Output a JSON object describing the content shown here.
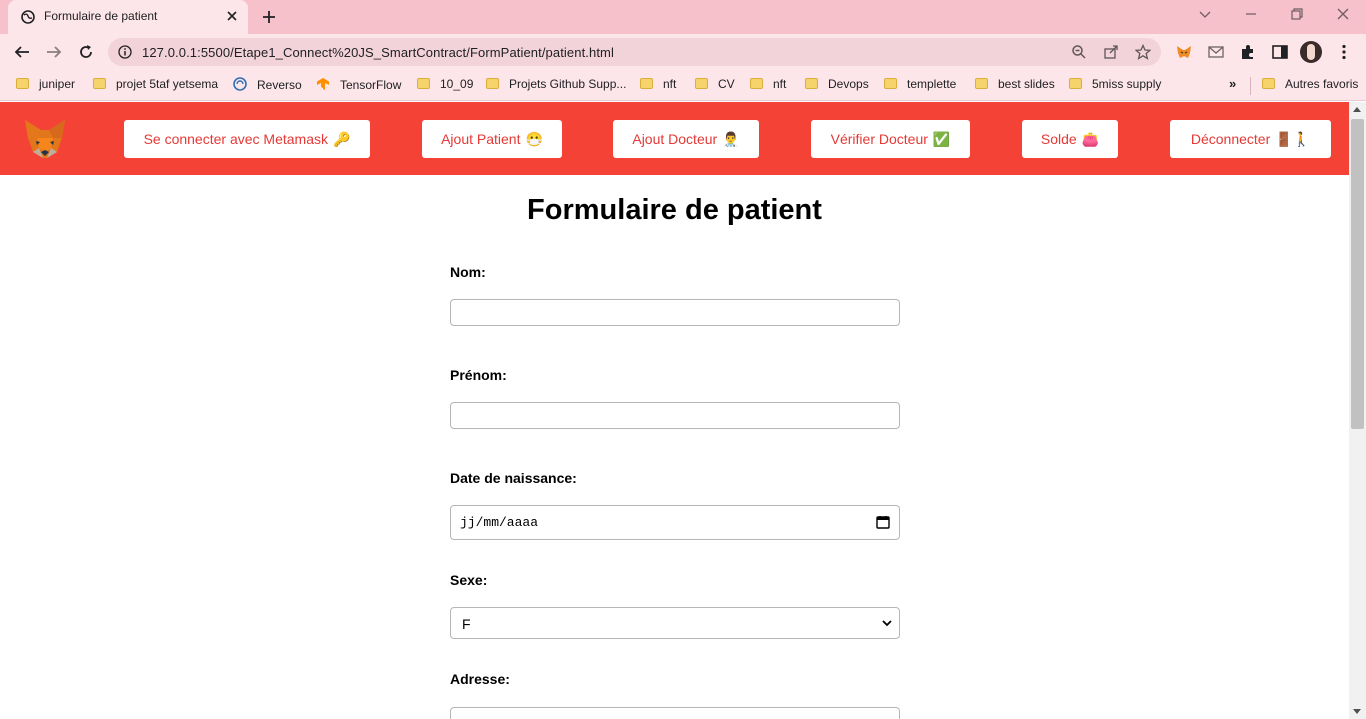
{
  "browser": {
    "tab_title": "Formulaire de patient",
    "url": "127.0.0.1:5500/Etape1_Connect%20JS_SmartContract/FormPatient/patient.html",
    "bookmarks": [
      {
        "label": "juniper",
        "icon": "folder-icon"
      },
      {
        "label": "projet 5taf yetsema",
        "icon": "folder-icon"
      },
      {
        "label": "Reverso",
        "icon": "reverso-icon"
      },
      {
        "label": "TensorFlow",
        "icon": "tensorflow-icon"
      },
      {
        "label": "10_09",
        "icon": "folder-icon"
      },
      {
        "label": "Projets Github Supp...",
        "icon": "folder-icon"
      },
      {
        "label": "nft",
        "icon": "folder-icon"
      },
      {
        "label": "CV",
        "icon": "folder-icon"
      },
      {
        "label": "nft",
        "icon": "folder-icon"
      },
      {
        "label": "Devops",
        "icon": "folder-icon"
      },
      {
        "label": "templette",
        "icon": "folder-icon"
      },
      {
        "label": "best slides",
        "icon": "folder-icon"
      },
      {
        "label": "5miss supply",
        "icon": "folder-icon"
      }
    ],
    "bookmarks_more": "»",
    "other_bookmarks": "Autres favoris"
  },
  "navbar": {
    "logo_icon": "metamask-fox-icon",
    "buttons": [
      {
        "label": "Se connecter avec Metamask",
        "emoji": "🔑"
      },
      {
        "label": "Ajout Patient",
        "emoji": "😷"
      },
      {
        "label": "Ajout Docteur",
        "emoji": "👨‍⚕️"
      },
      {
        "label": "Vérifier Docteur",
        "emoji": "✅"
      },
      {
        "label": "Solde",
        "emoji": "👛"
      },
      {
        "label": "Déconnecter",
        "emoji": "🚪🚶"
      }
    ]
  },
  "form": {
    "title": "Formulaire de patient",
    "nom_label": "Nom:",
    "nom_value": "",
    "prenom_label": "Prénom:",
    "prenom_value": "",
    "dob_label": "Date de naissance:",
    "dob_placeholder": "jj/mm/aaaa",
    "sexe_label": "Sexe:",
    "sexe_value": "F",
    "adresse_label": "Adresse:"
  },
  "colors": {
    "navbar_bg": "#f44336",
    "nav_button_text": "#e53935",
    "chrome_tabstrip": "#f7c1cb",
    "chrome_toolbar": "#fde6ea"
  }
}
